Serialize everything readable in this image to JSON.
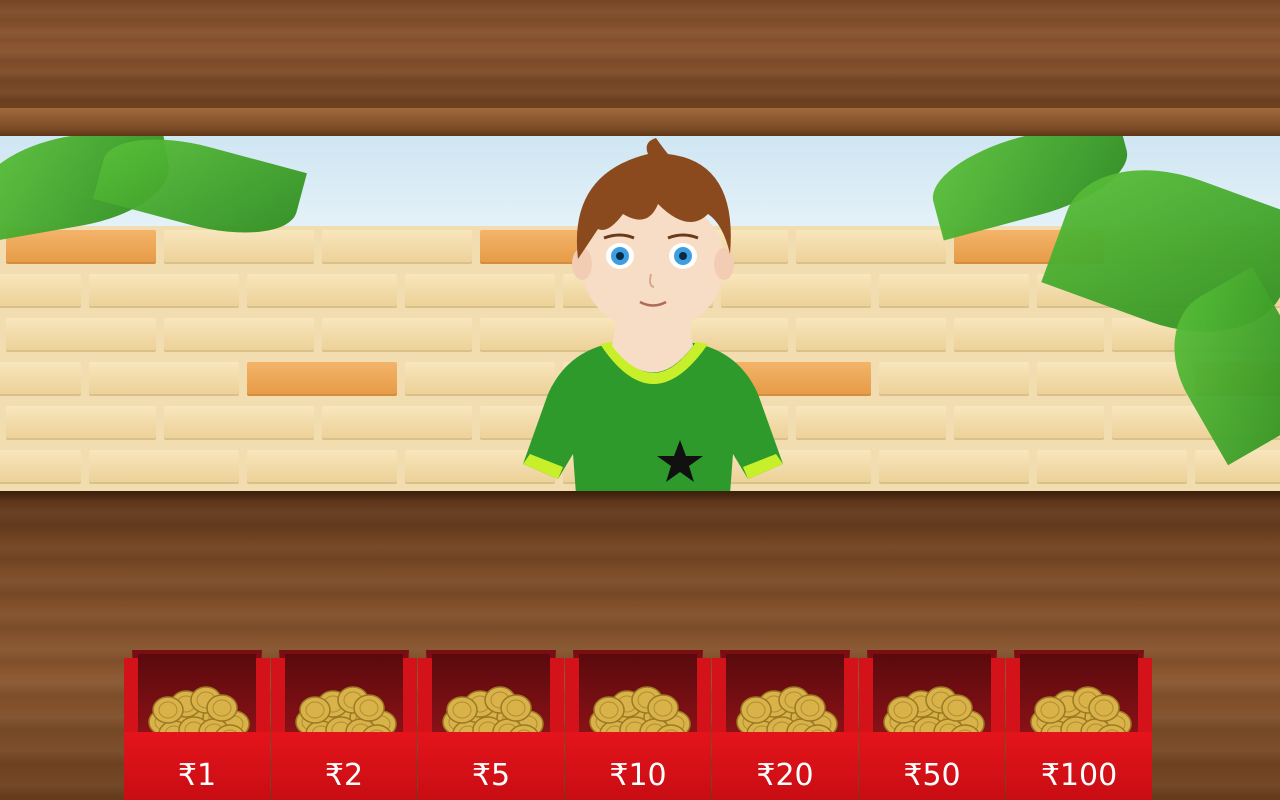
{
  "scene": {
    "character": "boy-shopkeeper",
    "shirt_color": "#2e9a2b",
    "shirt_trim": "#c8f02a"
  },
  "coin_boxes": [
    {
      "label": "₹1"
    },
    {
      "label": "₹2"
    },
    {
      "label": "₹5"
    },
    {
      "label": "₹10"
    },
    {
      "label": "₹20"
    },
    {
      "label": "₹50"
    },
    {
      "label": "₹100"
    }
  ],
  "colors": {
    "box_red": "#e4141b",
    "coin_gold": "#d9b24a",
    "wood": "#7a4a26"
  }
}
